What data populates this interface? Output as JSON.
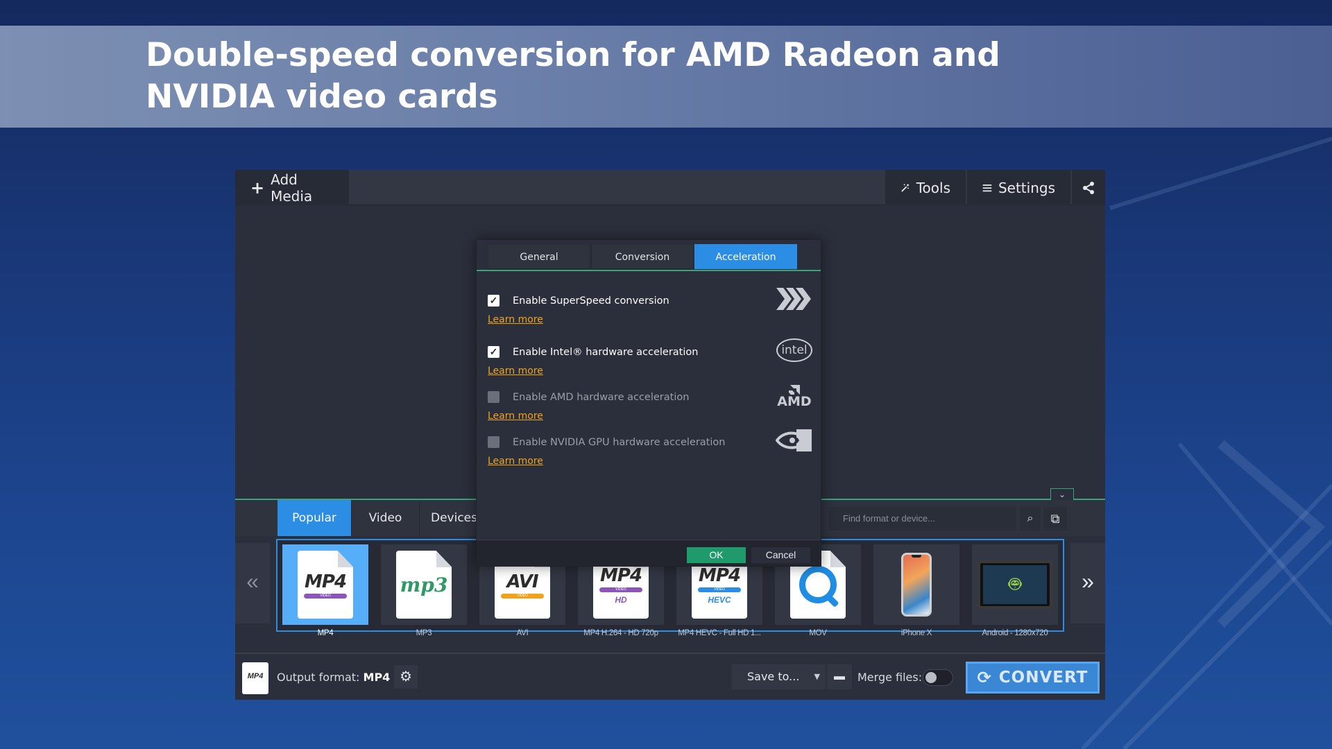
{
  "banner": {
    "title": "Double-speed conversion for AMD Radeon and NVIDIA video cards"
  },
  "toolbar": {
    "add_media": "Add Media",
    "tools": "Tools",
    "settings": "Settings"
  },
  "dialog": {
    "tabs": [
      "General",
      "Conversion",
      "Acceleration"
    ],
    "active_tab": "Acceleration",
    "options": [
      {
        "label": "Enable SuperSpeed conversion",
        "checked": true,
        "learn_more": "Learn more",
        "icon": "superspeed-chevrons-icon"
      },
      {
        "label": "Enable Intel® hardware acceleration",
        "checked": true,
        "learn_more": "Learn more",
        "icon": "intel-logo-icon",
        "logo_text": "intel"
      },
      {
        "label": "Enable AMD hardware acceleration",
        "checked": false,
        "learn_more": "Learn more",
        "icon": "amd-logo-icon",
        "logo_text": "AMD"
      },
      {
        "label": "Enable NVIDIA GPU hardware acceleration",
        "checked": false,
        "learn_more": "Learn more",
        "icon": "nvidia-logo-icon"
      }
    ],
    "ok": "OK",
    "cancel": "Cancel"
  },
  "formats": {
    "tabs": [
      "Popular",
      "Video",
      "Devices"
    ],
    "active_tab": "Popular",
    "search_placeholder": "Find format or device...",
    "tiles": [
      {
        "label": "MP4",
        "icon_text": "MP4",
        "band": "VIDEO",
        "selected": true
      },
      {
        "label": "MP3",
        "icon_text": "mp3",
        "selected": false
      },
      {
        "label": "AVI",
        "icon_text": "AVI",
        "band": "VIDEO",
        "selected": false
      },
      {
        "label": "MP4 H.264 - HD 720p",
        "icon_text": "MP4",
        "band": "VIDEO",
        "sub": "HD",
        "selected": false
      },
      {
        "label": "MP4 HEVC - Full HD 1...",
        "icon_text": "MP4",
        "band": "VIDEO",
        "sub": "HEVC",
        "selected": false
      },
      {
        "label": "MOV",
        "selected": false
      },
      {
        "label": "iPhone X",
        "selected": false
      },
      {
        "label": "Android - 1280x720",
        "selected": false
      }
    ]
  },
  "bottom": {
    "output_label": "Output format:",
    "output_value": "MP4",
    "output_icon_text": "MP4",
    "save_to": "Save to...",
    "merge_files": "Merge files:",
    "merge_on": false,
    "convert": "CONVERT"
  },
  "colors": {
    "accent": "#2c8de4",
    "green": "#3aa37c",
    "link": "#f1a31a"
  }
}
